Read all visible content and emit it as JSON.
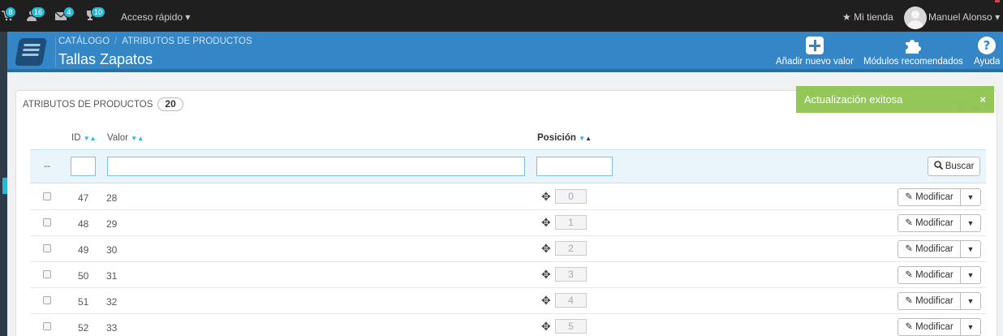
{
  "topbar": {
    "notifications": [
      {
        "icon": "cart-icon",
        "count": "8"
      },
      {
        "icon": "users-icon",
        "count": "16"
      },
      {
        "icon": "mail-icon",
        "count": "4"
      },
      {
        "icon": "trophy-icon",
        "count": "10"
      }
    ],
    "quick_access": "Acceso rápido",
    "my_store": "Mi tienda",
    "user_name": "Manuel Alonso"
  },
  "header": {
    "breadcrumb": [
      "CATÁLOGO",
      "ATRIBUTOS DE PRODUCTOS"
    ],
    "title": "Tallas Zapatos",
    "toolbar": {
      "add": "Añadir nuevo valor",
      "modules": "Módulos recomendados",
      "help": "Ayuda"
    }
  },
  "panel": {
    "title": "ATRIBUTOS DE PRODUCTOS",
    "count": "20"
  },
  "toast": {
    "message": "Actualización exitosa",
    "close": "×"
  },
  "table": {
    "columns": {
      "id": "ID",
      "value": "Valor",
      "position": "Posición"
    },
    "filter_dash": "--",
    "search_label": "Buscar",
    "modify_label": "Modificar",
    "rows": [
      {
        "id": "47",
        "value": "28",
        "position": "0"
      },
      {
        "id": "48",
        "value": "29",
        "position": "1"
      },
      {
        "id": "49",
        "value": "30",
        "position": "2"
      },
      {
        "id": "50",
        "value": "31",
        "position": "3"
      },
      {
        "id": "51",
        "value": "32",
        "position": "4"
      },
      {
        "id": "52",
        "value": "33",
        "position": "5"
      }
    ]
  },
  "colors": {
    "topbar": "#1f1f1f",
    "header": "#3586c6",
    "accent": "#25b9d7",
    "toast": "#8bc34a"
  }
}
